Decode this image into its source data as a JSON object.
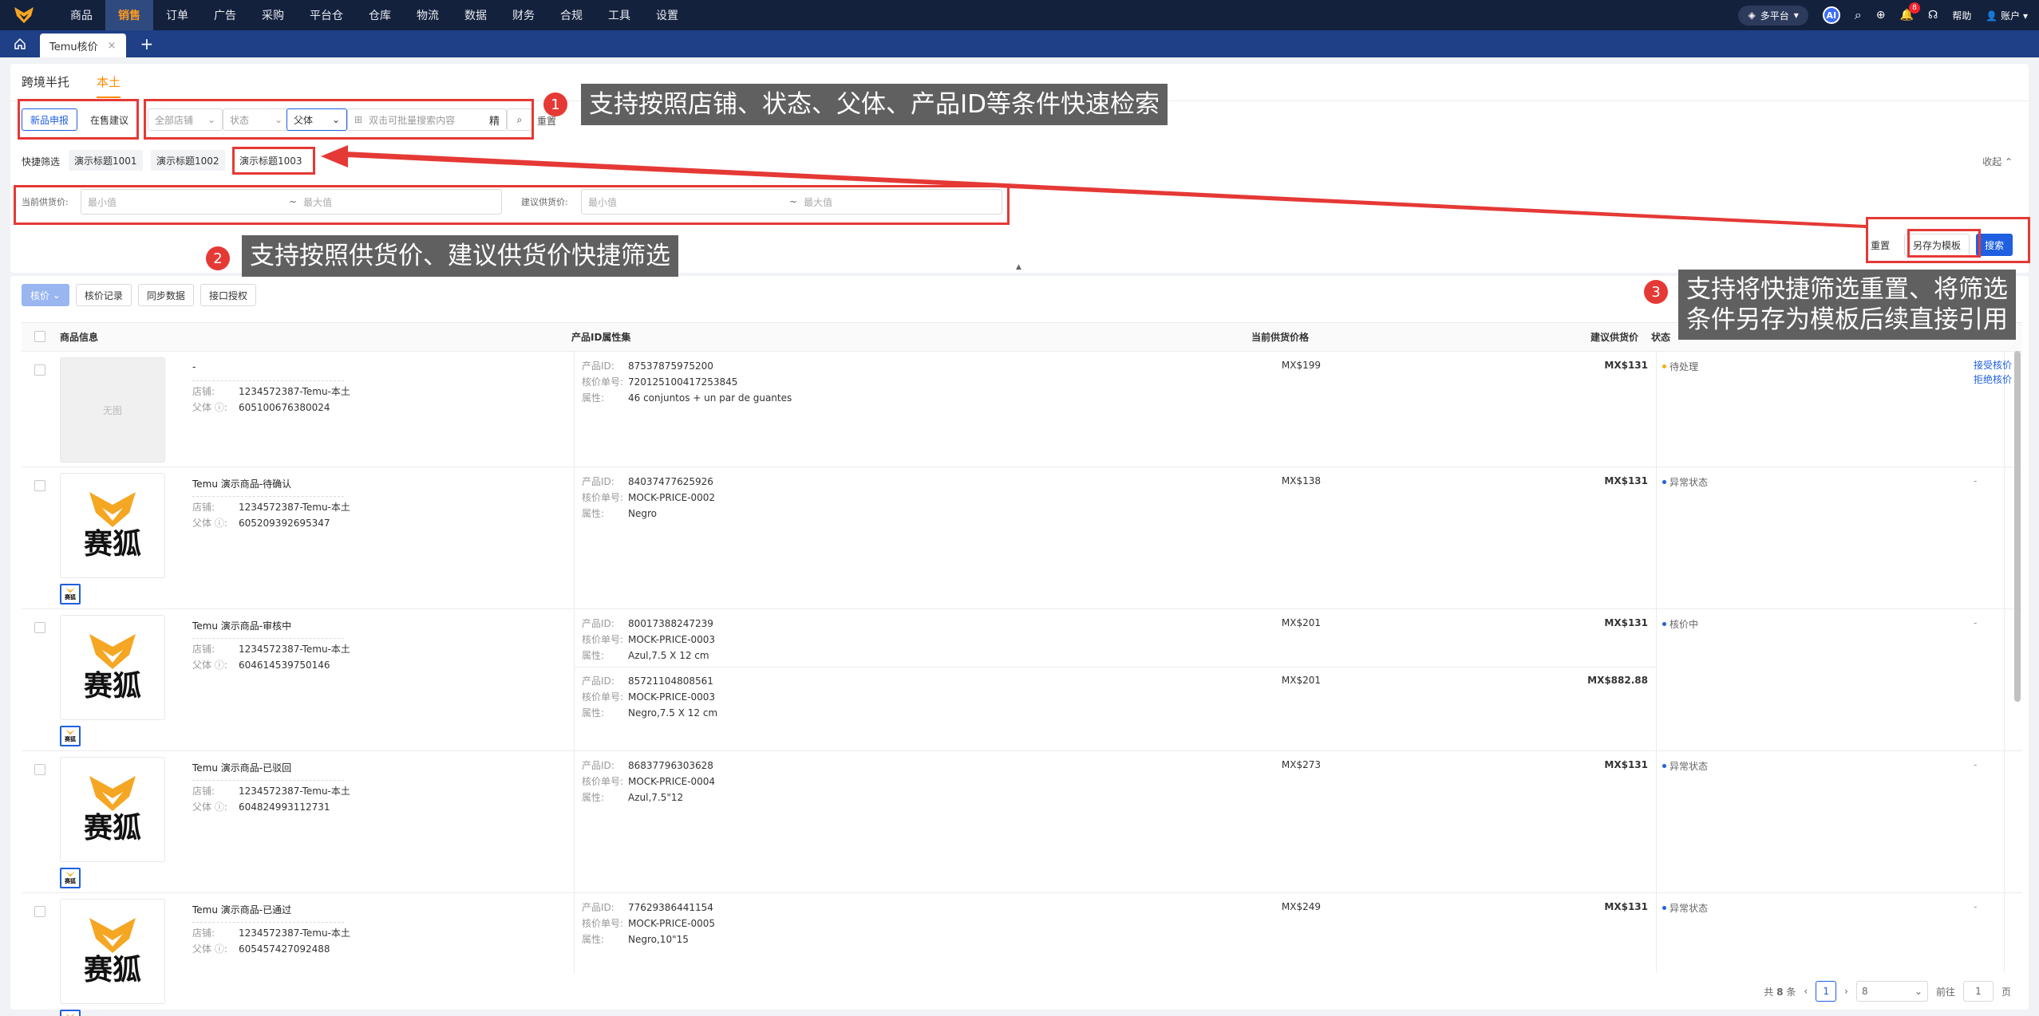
{
  "nav": {
    "items": [
      "商品",
      "销售",
      "订单",
      "广告",
      "采购",
      "平台仓",
      "仓库",
      "物流",
      "数据",
      "财务",
      "合规",
      "工具",
      "设置"
    ],
    "platform": "多平台",
    "ai": "AI",
    "notif_count": "8",
    "help": "帮助",
    "account": "账户"
  },
  "tabs": {
    "current": "Temu核价",
    "close": "×",
    "add": "+"
  },
  "subtabs": [
    "跨境半托",
    "本土"
  ],
  "filters": {
    "new_report": "新品申报",
    "on_sale": "在售建议",
    "store_placeholder": "全部店铺",
    "status_placeholder": "状态",
    "parent_label": "父体",
    "search_placeholder": "双击可批量搜索内容",
    "precise": "精",
    "reset_partial": "重置",
    "quick_label": "快捷筛选",
    "chips": [
      "演示标题1001",
      "演示标题1002",
      "演示标题1003"
    ],
    "collapse": "收起",
    "current_price_label": "当前供货价:",
    "suggest_price_label": "建议供货价:",
    "min": "最小值",
    "max": "最大值",
    "tilde": "~",
    "reset": "重置",
    "save_template": "另存为模板",
    "search": "搜索"
  },
  "callouts": {
    "c1": "支持按照店铺、状态、父体、产品ID等条件快速检索",
    "c2": "支持按照供货价、建议供货价快捷筛选",
    "c3a": "支持将快捷筛选重置、将筛选",
    "c3b": "条件另存为模板后续直接引用",
    "n1": "1",
    "n2": "2",
    "n3": "3"
  },
  "toolbar": {
    "price_check": "核价",
    "history": "核价记录",
    "sync": "同步数据",
    "auth": "接口授权"
  },
  "columns": {
    "info": "商品信息",
    "attrs": "产品ID属性集",
    "current": "当前供货价格",
    "suggest": "建议供货价",
    "status": "状态"
  },
  "labels": {
    "store": "店铺:",
    "parent": "父体",
    "pid": "产品ID:",
    "order": "核价单号:",
    "attr": "属性:",
    "no_image": "无图",
    "fox": "赛狐",
    "fox_mini": "赛狐"
  },
  "rows": [
    {
      "title": "-",
      "store": "1234572387-Temu-本土",
      "parent": "605100676380024",
      "noimg": true,
      "skus": [
        {
          "pid": "87537875975200",
          "order": "720125100417253845",
          "attr": "46 conjuntos + un par de guantes",
          "cur": "MX$199",
          "sug": "MX$131"
        }
      ],
      "status": "待处理",
      "status_color": "#faad14",
      "actions": [
        "接受核价",
        "拒绝核价"
      ]
    },
    {
      "title": "Temu 演示商品-待确认",
      "store": "1234572387-Temu-本土",
      "parent": "605209392695347",
      "skus": [
        {
          "pid": "84037477625926",
          "order": "MOCK-PRICE-0002",
          "attr": "Negro",
          "cur": "MX$138",
          "sug": "MX$131"
        }
      ],
      "status": "异常状态",
      "status_color": "#1f5fe0",
      "actions": [
        "-"
      ]
    },
    {
      "title": "Temu 演示商品-审核中",
      "store": "1234572387-Temu-本土",
      "parent": "604614539750146",
      "skus": [
        {
          "pid": "80017388247239",
          "order": "MOCK-PRICE-0003",
          "attr": "Azul,7.5 X 12 cm",
          "cur": "MX$201",
          "sug": "MX$131"
        },
        {
          "pid": "85721104808561",
          "order": "MOCK-PRICE-0003",
          "attr": "Negro,7.5 X 12 cm",
          "cur": "MX$201",
          "sug": "MX$882.88"
        }
      ],
      "status": "核价中",
      "status_color": "#1f5fe0",
      "actions": [
        "-"
      ]
    },
    {
      "title": "Temu 演示商品-已驳回",
      "store": "1234572387-Temu-本土",
      "parent": "604824993112731",
      "skus": [
        {
          "pid": "86837796303628",
          "order": "MOCK-PRICE-0004",
          "attr": "Azul,7.5\"12",
          "cur": "MX$273",
          "sug": "MX$131"
        }
      ],
      "status": "异常状态",
      "status_color": "#1f5fe0",
      "actions": [
        "-"
      ]
    },
    {
      "title": "Temu 演示商品-已通过",
      "store": "1234572387-Temu-本土",
      "parent": "605457427092488",
      "skus": [
        {
          "pid": "77629386441154",
          "order": "MOCK-PRICE-0005",
          "attr": "Negro,10\"15",
          "cur": "MX$249",
          "sug": "MX$131"
        }
      ],
      "status": "异常状态",
      "status_color": "#1f5fe0",
      "actions": [
        "-"
      ]
    }
  ],
  "pager": {
    "total_prefix": "共",
    "total": "8",
    "total_suffix": "条",
    "page": "1",
    "page_size": "8",
    "goto": "前往",
    "goto_val": "1",
    "page_unit": "页"
  },
  "colors": {
    "nav_bg": "#14213d",
    "accent": "#ff8a00",
    "primary": "#1f5fe0",
    "annotation": "#e53935"
  }
}
